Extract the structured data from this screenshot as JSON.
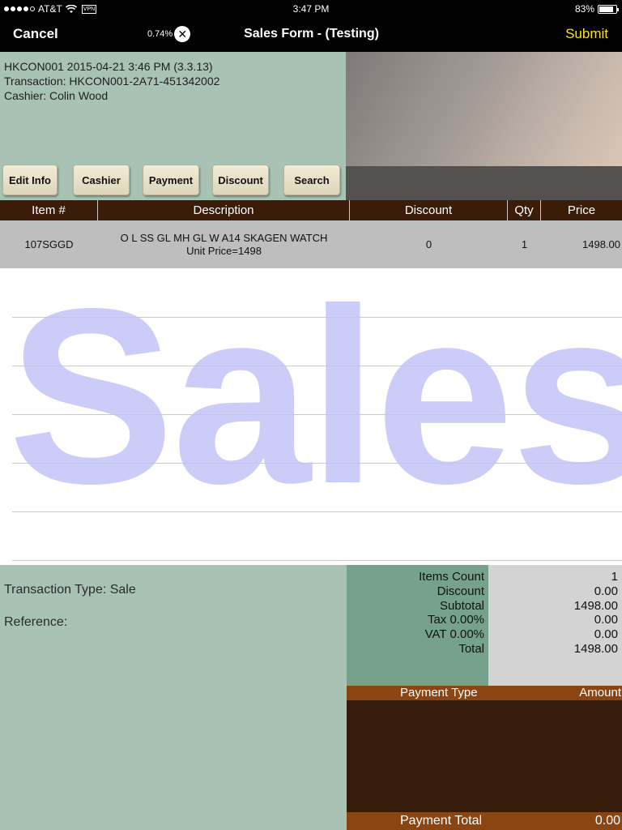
{
  "status": {
    "carrier": "AT&T",
    "vpn": "VPN",
    "time": "3:47 PM",
    "battery": "83%",
    "battery_level": 0.83
  },
  "nav": {
    "cancel": "Cancel",
    "progress": "0.74%",
    "clear_glyph": "✕",
    "title": "Sales Form - (Testing)",
    "submit": "Submit"
  },
  "info": {
    "line1": "HKCON001 2015-04-21 3:46 PM (3.3.13)",
    "line2": "Transaction: HKCON001-2A71-451342002",
    "line3": "Cashier: Colin Wood"
  },
  "buttons": {
    "edit_info": "Edit Info",
    "cashier": "Cashier",
    "payment": "Payment",
    "discount": "Discount",
    "search": "Search"
  },
  "table": {
    "headers": {
      "item": "Item #",
      "description": "Description",
      "discount": "Discount",
      "qty": "Qty",
      "price": "Price"
    },
    "rows": [
      {
        "item": "107SGGD",
        "description": "O L SS GL MH GL W A14 SKAGEN WATCH",
        "unit_price": "Unit Price=1498",
        "discount": "0",
        "qty": "1",
        "price": "1498.00"
      }
    ]
  },
  "watermark": "Sales",
  "transaction": {
    "type": "Transaction Type: Sale",
    "reference": "Reference:"
  },
  "totals": {
    "items_count_label": "Items Count",
    "items_count": "1",
    "discount_label": "Discount",
    "discount": "0.00",
    "subtotal_label": "Subtotal",
    "subtotal": "1498.00",
    "tax_label": "Tax 0.00%",
    "tax": "0.00",
    "vat_label": "VAT 0.00%",
    "vat": "0.00",
    "total_label": "Total",
    "total": "1498.00"
  },
  "payment": {
    "type_header": "Payment Type",
    "amount_header": "Amount",
    "total_label": "Payment Total",
    "total": "0.00"
  },
  "colors": {
    "accent_submit": "#ffe119",
    "panel_green": "#a8c3b3",
    "header_brown": "#3a1c09",
    "payment_brown": "#8b4513"
  }
}
